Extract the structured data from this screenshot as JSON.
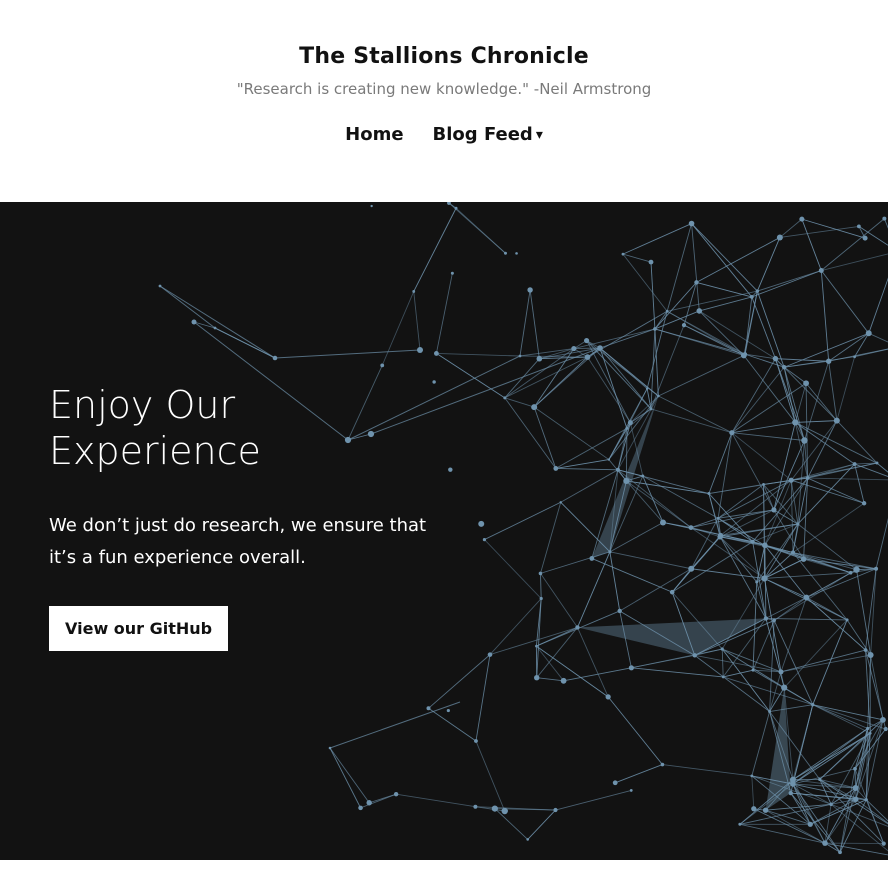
{
  "header": {
    "title": "The Stallions Chronicle",
    "tagline": "\"Research is creating new knowledge.\" -Neil Armstrong"
  },
  "nav": {
    "items": [
      {
        "label": "Home"
      },
      {
        "label": "Blog Feed"
      }
    ],
    "dropdown_caret": "▾"
  },
  "hero": {
    "heading": "Enjoy Our Experience",
    "text": "We don’t just do research, we ensure that it’s a fun experience overall.",
    "button_label": "View our GitHub",
    "background_color": "#121212",
    "network_color": "#6f93ad",
    "background_image": "network-graph"
  }
}
